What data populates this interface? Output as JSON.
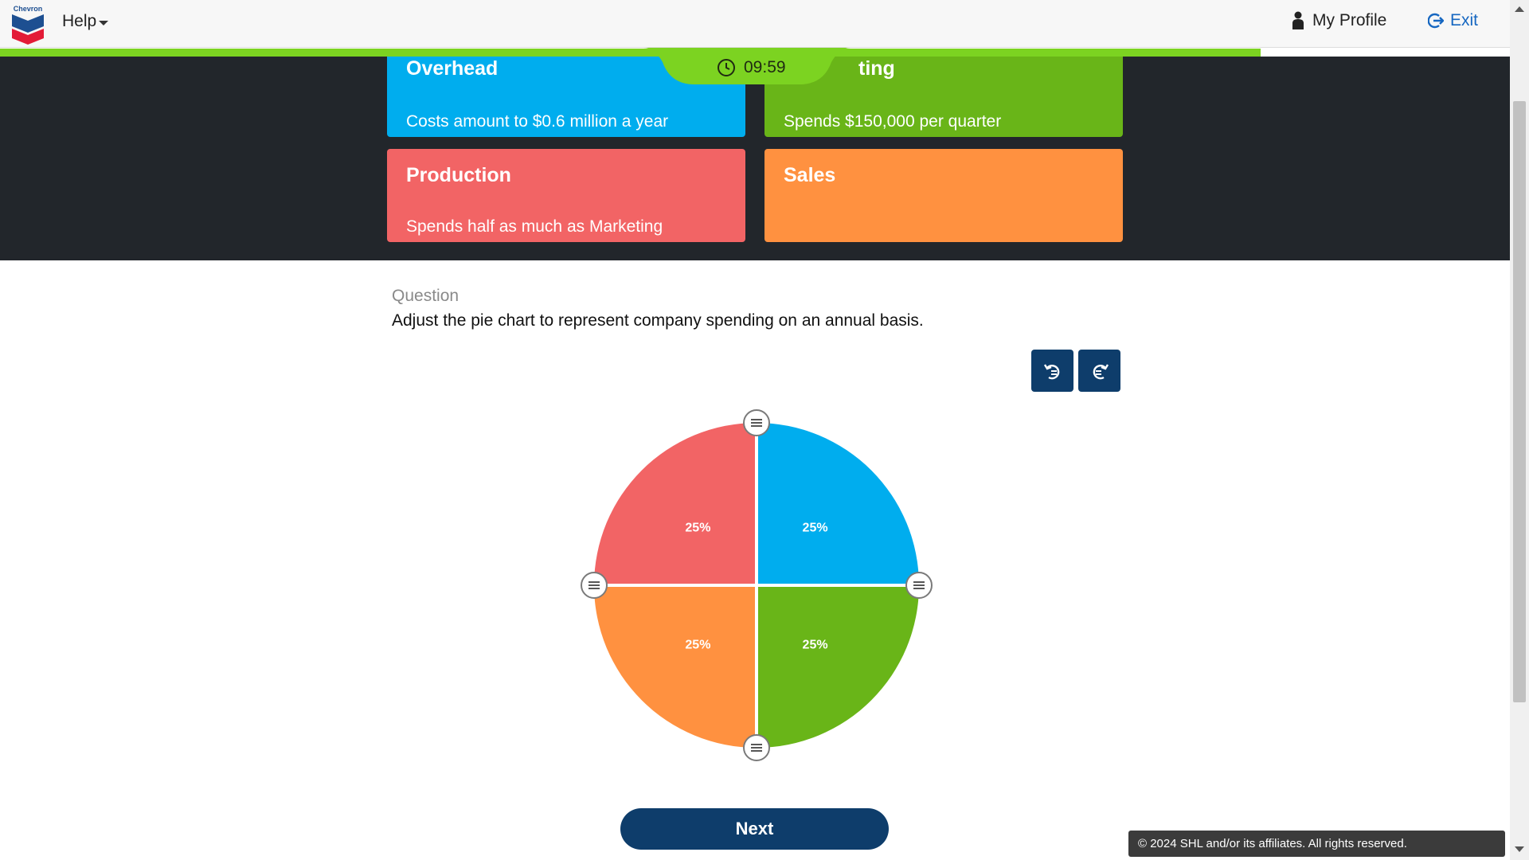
{
  "header": {
    "logo_text": "Chevron",
    "help_label": "Help",
    "profile_label": "My Profile",
    "exit_label": "Exit",
    "icons": {
      "help_caret": "caret-down-icon",
      "profile": "person-icon",
      "exit": "exit-icon"
    }
  },
  "progress": {
    "fraction": 0.835,
    "color": "#7cd321"
  },
  "timer": {
    "value": "09:59",
    "icon": "clock-icon"
  },
  "cards": {
    "overhead": {
      "title": "Overhead",
      "desc": "Costs amount to $0.6 million a year",
      "color": "#00adee"
    },
    "marketing": {
      "title": "Marketing",
      "title_visible": "ting",
      "desc": "Spends $150,000 per quarter",
      "color": "#69b518"
    },
    "production": {
      "title": "Production",
      "desc": "Spends half as much as Marketing",
      "color": "#f26465"
    },
    "sales": {
      "title": "Sales",
      "desc": "",
      "color": "#ff9140"
    }
  },
  "question": {
    "label": "Question",
    "text": "Adjust the pie chart to represent company spending on an annual basis."
  },
  "toolbar": {
    "undo_icon": "undo-icon",
    "redo_icon": "redo-icon"
  },
  "chart_data": {
    "type": "pie",
    "slices": [
      {
        "name": "Overhead",
        "value": 25,
        "label": "25%",
        "color": "#00adee"
      },
      {
        "name": "Marketing",
        "value": 25,
        "label": "25%",
        "color": "#69b518"
      },
      {
        "name": "Sales",
        "value": 25,
        "label": "25%",
        "color": "#ff9140"
      },
      {
        "name": "Production",
        "value": 25,
        "label": "25%",
        "color": "#f26465"
      }
    ],
    "order": "clockwise-from-top",
    "handles": 4
  },
  "next_label": "Next",
  "footer": {
    "copyright": "© 2024 SHL and/or its affiliates. All rights reserved."
  }
}
